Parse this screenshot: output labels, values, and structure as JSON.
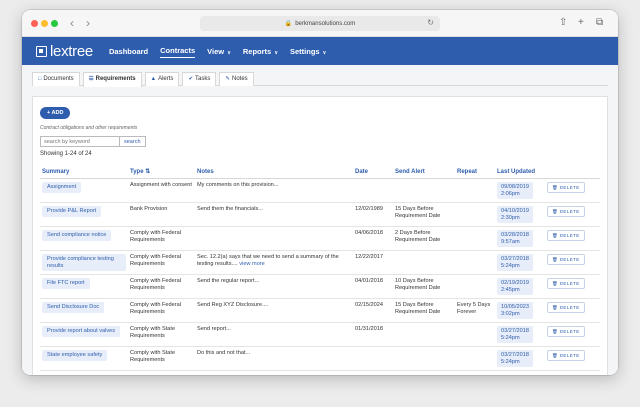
{
  "browser": {
    "url": "berkmansolutions.com"
  },
  "app": {
    "logo": "lextree",
    "nav": [
      {
        "label": "Dashboard",
        "dropdown": false,
        "active": false
      },
      {
        "label": "Contracts",
        "dropdown": false,
        "active": true
      },
      {
        "label": "View",
        "dropdown": true,
        "active": false
      },
      {
        "label": "Reports",
        "dropdown": true,
        "active": false
      },
      {
        "label": "Settings",
        "dropdown": true,
        "active": false
      }
    ]
  },
  "tabs": [
    {
      "label": "Documents",
      "icon": "document-icon",
      "active": false
    },
    {
      "label": "Requirements",
      "icon": "list-icon",
      "active": true
    },
    {
      "label": "Alerts",
      "icon": "bell-icon",
      "active": false
    },
    {
      "label": "Tasks",
      "icon": "check-circle-icon",
      "active": false
    },
    {
      "label": "Notes",
      "icon": "edit-icon",
      "active": false
    }
  ],
  "toolbar": {
    "add_label": "+ ADD",
    "subtitle": "Contract obligations and other requirements",
    "search_placeholder": "search by keyword",
    "search_button": "search",
    "showing": "Showing 1-24 of 24"
  },
  "table": {
    "headers": [
      "Summary",
      "Type",
      "Notes",
      "Date",
      "Send Alert",
      "Repeat",
      "Last Updated",
      ""
    ],
    "delete_label": "DELETE",
    "rows": [
      {
        "summary": "Assignment",
        "type": "Assignment with consent",
        "notes": "My comments on this provision...",
        "notes_link": "",
        "date": "",
        "alert": "",
        "repeat": "",
        "updated_date": "09/08/2019",
        "updated_time": "2:06pm"
      },
      {
        "summary": "Provide P&L Report",
        "type": "Bank Provision",
        "notes": "Send them the financials...",
        "notes_link": "",
        "date": "12/02/1989",
        "alert": "15 Days Before Requirement Date",
        "repeat": "",
        "updated_date": "04/10/2019",
        "updated_time": "2:30pm"
      },
      {
        "summary": "Send compliance notice",
        "type": "Comply with Federal Requirements",
        "notes": "",
        "notes_link": "",
        "date": "04/06/2018",
        "alert": "2 Days Before Requirement Date",
        "repeat": "",
        "updated_date": "03/28/2018",
        "updated_time": "9:57am"
      },
      {
        "summary": "Provide compliance testing results",
        "type": "Comply with Federal Requirements",
        "notes": "Sec. 12.2(a) says that we need to send a summary of the testing results....",
        "notes_link": "view more",
        "date": "12/22/2017",
        "alert": "",
        "repeat": "",
        "updated_date": "03/27/2018",
        "updated_time": "5:24pm"
      },
      {
        "summary": "File FTC report",
        "type": "Comply with Federal Requirements",
        "notes": "Send the regular report...",
        "notes_link": "",
        "date": "04/01/2018",
        "alert": "10 Days Before Requirement Date",
        "repeat": "",
        "updated_date": "02/19/2019",
        "updated_time": "2:45pm"
      },
      {
        "summary": "Send Disclosure Doc",
        "type": "Comply with Federal Requirements",
        "notes": "Send Reg XYZ Disclosure....",
        "notes_link": "",
        "date": "02/15/2024",
        "alert": "15 Days Before Requirement Date",
        "repeat": "Every 5 Days Forever",
        "updated_date": "10/05/2023",
        "updated_time": "3:02pm"
      },
      {
        "summary": "Provide report about valves",
        "type": "Comply with State Requirements",
        "notes": "Send report...",
        "notes_link": "",
        "date": "01/31/2018",
        "alert": "",
        "repeat": "",
        "updated_date": "03/27/2018",
        "updated_time": "5:24pm"
      },
      {
        "summary": "State employee safety",
        "type": "Comply with State Requirements",
        "notes": "Do this and not that...",
        "notes_link": "",
        "date": "",
        "alert": "",
        "repeat": "",
        "updated_date": "03/27/2018",
        "updated_time": "5:24pm"
      }
    ]
  }
}
